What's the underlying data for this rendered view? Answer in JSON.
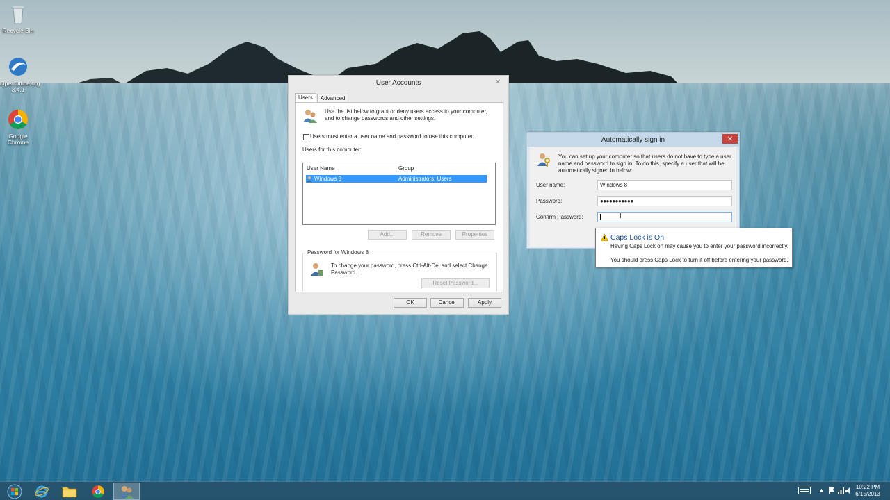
{
  "desktop": {
    "icons": [
      {
        "label": "Recycle Bin",
        "icon": "recycle-bin-icon"
      },
      {
        "label": "OpenOffice.org 3.4.1",
        "icon": "openoffice-icon"
      },
      {
        "label": "Google Chrome",
        "icon": "chrome-icon"
      }
    ]
  },
  "user_accounts": {
    "title": "User Accounts",
    "tabs": [
      "Users",
      "Advanced"
    ],
    "intro": "Use the list below to grant or deny users access to your computer, and to change passwords and other settings.",
    "require_login_label": "Users must enter a user name and password to use this computer.",
    "users_label": "Users for this computer:",
    "columns": [
      "User Name",
      "Group"
    ],
    "rows": [
      {
        "name": "Windows 8",
        "group": "Administrators; Users"
      }
    ],
    "buttons": {
      "add": "Add...",
      "remove": "Remove",
      "properties": "Properties"
    },
    "password_group_label": "Password for Windows 8",
    "password_text": "To change your password, press Ctrl-Alt-Del and select Change Password.",
    "reset_password": "Reset Password...",
    "ok": "OK",
    "cancel": "Cancel",
    "apply": "Apply"
  },
  "auto_sign_in": {
    "title": "Automatically sign in",
    "intro": "You can set up your computer so that users do not have to type a user name and password to sign in. To do this, specify a user that will be automatically signed in below:",
    "username_label": "User name:",
    "username_value": "Windows 8",
    "password_label": "Password:",
    "password_value": "●●●●●●●●●●●",
    "confirm_label": "Confirm Password:",
    "confirm_value": ""
  },
  "caps_tooltip": {
    "title": "Caps Lock is On",
    "line1": "Having Caps Lock on may cause you to enter your password incorrectly.",
    "line2": "You should press Caps Lock to turn it off before entering your password."
  },
  "taskbar": {
    "pinned": [
      "start-icon",
      "internet-explorer-icon",
      "file-explorer-icon",
      "chrome-icon",
      "user-accounts-icon"
    ],
    "time": "10:22 PM",
    "date": "6/15/2013"
  }
}
